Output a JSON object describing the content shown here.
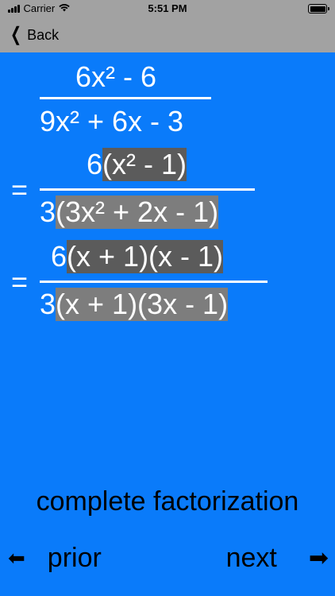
{
  "status_bar": {
    "carrier": "Carrier",
    "time": "5:51 PM"
  },
  "nav": {
    "back_label": "Back"
  },
  "math": {
    "line1_num": "6x² - 6",
    "line1_den": "9x² + 6x - 3",
    "eq_sign": "=",
    "line2_num_coef": "6",
    "line2_num_factor": "(x² - 1)",
    "line2_den_coef": "3",
    "line2_den_factor": "(3x² + 2x - 1)",
    "line3_num_coef": "6",
    "line3_num_factor": "(x + 1)(x - 1)",
    "line3_den_coef": "3",
    "line3_den_factor": "(x + 1)(3x - 1)"
  },
  "caption": "complete factorization",
  "footer": {
    "prior_label": "prior",
    "next_label": "next",
    "prior_icon": "left-arrow-icon",
    "next_icon": "right-arrow-icon"
  }
}
